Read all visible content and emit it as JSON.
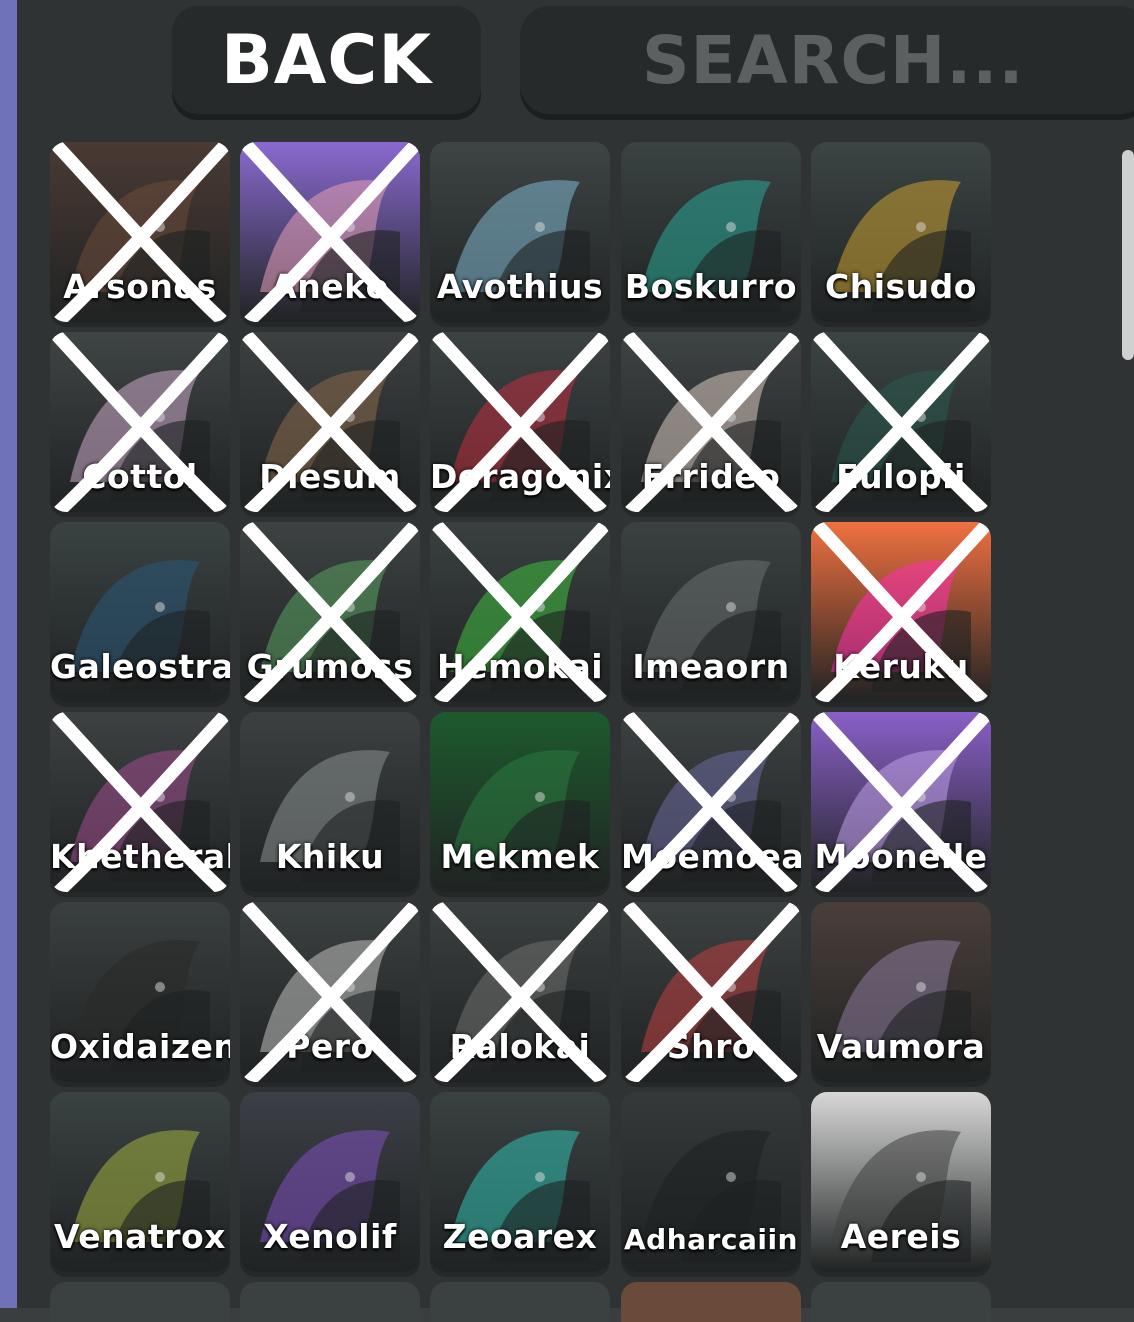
{
  "header": {
    "back_label": "BACK",
    "search_placeholder": "SEARCH..."
  },
  "tiles": [
    {
      "name": "Arsonos",
      "crossed": true,
      "bg": "#4a3a34",
      "accent": "#6b4a3a"
    },
    {
      "name": "Aneko",
      "crossed": true,
      "bg": "#8a6ad0",
      "accent": "#e6a0b8"
    },
    {
      "name": "Avothius",
      "crossed": false,
      "bg": "#3e4545",
      "accent": "#7fb6d0"
    },
    {
      "name": "Boskurro",
      "crossed": false,
      "bg": "#3a4242",
      "accent": "#2aa898"
    },
    {
      "name": "Chisudo",
      "crossed": false,
      "bg": "#3c4444",
      "accent": "#c8a030"
    },
    {
      "name": "Cottol",
      "crossed": true,
      "bg": "#3f4444",
      "accent": "#c8a8c8"
    },
    {
      "name": "Diesum",
      "crossed": true,
      "bg": "#3c4040",
      "accent": "#8a6a4a"
    },
    {
      "name": "Doragonix",
      "crossed": true,
      "bg": "#3c4242",
      "accent": "#c03040"
    },
    {
      "name": "Errideo",
      "crossed": true,
      "bg": "#3e4343",
      "accent": "#d8c8c0"
    },
    {
      "name": "Eulopii",
      "crossed": true,
      "bg": "#3b4343",
      "accent": "#2a5a50"
    },
    {
      "name": "Galeostra",
      "crossed": false,
      "bg": "#3a4242",
      "accent": "#2a5a7a"
    },
    {
      "name": "Grumoss",
      "crossed": true,
      "bg": "#3d4242",
      "accent": "#5aa060"
    },
    {
      "name": "Hemokai",
      "crossed": true,
      "bg": "#3a4040",
      "accent": "#40c040"
    },
    {
      "name": "Imeaorn",
      "crossed": false,
      "bg": "#3b4141",
      "accent": "#6a7070"
    },
    {
      "name": "Keruku",
      "crossed": true,
      "bg": "#f07040",
      "accent": "#ff30b0"
    },
    {
      "name": "Khetheral",
      "crossed": true,
      "bg": "#3d4141",
      "accent": "#a04a90"
    },
    {
      "name": "Khiku",
      "crossed": false,
      "bg": "#3b4040",
      "accent": "#8a9090"
    },
    {
      "name": "Mekmek",
      "crossed": false,
      "bg": "#1e5a2e",
      "accent": "#2a7a3e"
    },
    {
      "name": "Moemoea",
      "crossed": true,
      "bg": "#3c4141",
      "accent": "#6a6aa0"
    },
    {
      "name": "Moonelle",
      "crossed": true,
      "bg": "#8a60c8",
      "accent": "#c0a0e8"
    },
    {
      "name": "Oxidaizen",
      "crossed": false,
      "bg": "#3a3f3f",
      "accent": "#2a2a2a"
    },
    {
      "name": "Pero",
      "crossed": true,
      "bg": "#3b4040",
      "accent": "#c0c0c0"
    },
    {
      "name": "Ralokai",
      "crossed": true,
      "bg": "#3a3f3f",
      "accent": "#707070"
    },
    {
      "name": "Shro",
      "crossed": true,
      "bg": "#3c4141",
      "accent": "#c04040"
    },
    {
      "name": "Vaumora",
      "crossed": false,
      "bg": "#4a3e3a",
      "accent": "#8a7a9a"
    },
    {
      "name": "Venatrox",
      "crossed": false,
      "bg": "#3a4242",
      "accent": "#a0b040"
    },
    {
      "name": "Xenolif",
      "crossed": false,
      "bg": "#3c3f46",
      "accent": "#8050c0"
    },
    {
      "name": "Zeoarex",
      "crossed": false,
      "bg": "#3a4141",
      "accent": "#30c0b0"
    },
    {
      "name": "Adharcaiin",
      "crossed": false,
      "bg": "#353939",
      "accent": "#1e2020"
    },
    {
      "name": "Aereis",
      "crossed": false,
      "bg": "#d8d8d8",
      "accent": "#404040"
    }
  ]
}
